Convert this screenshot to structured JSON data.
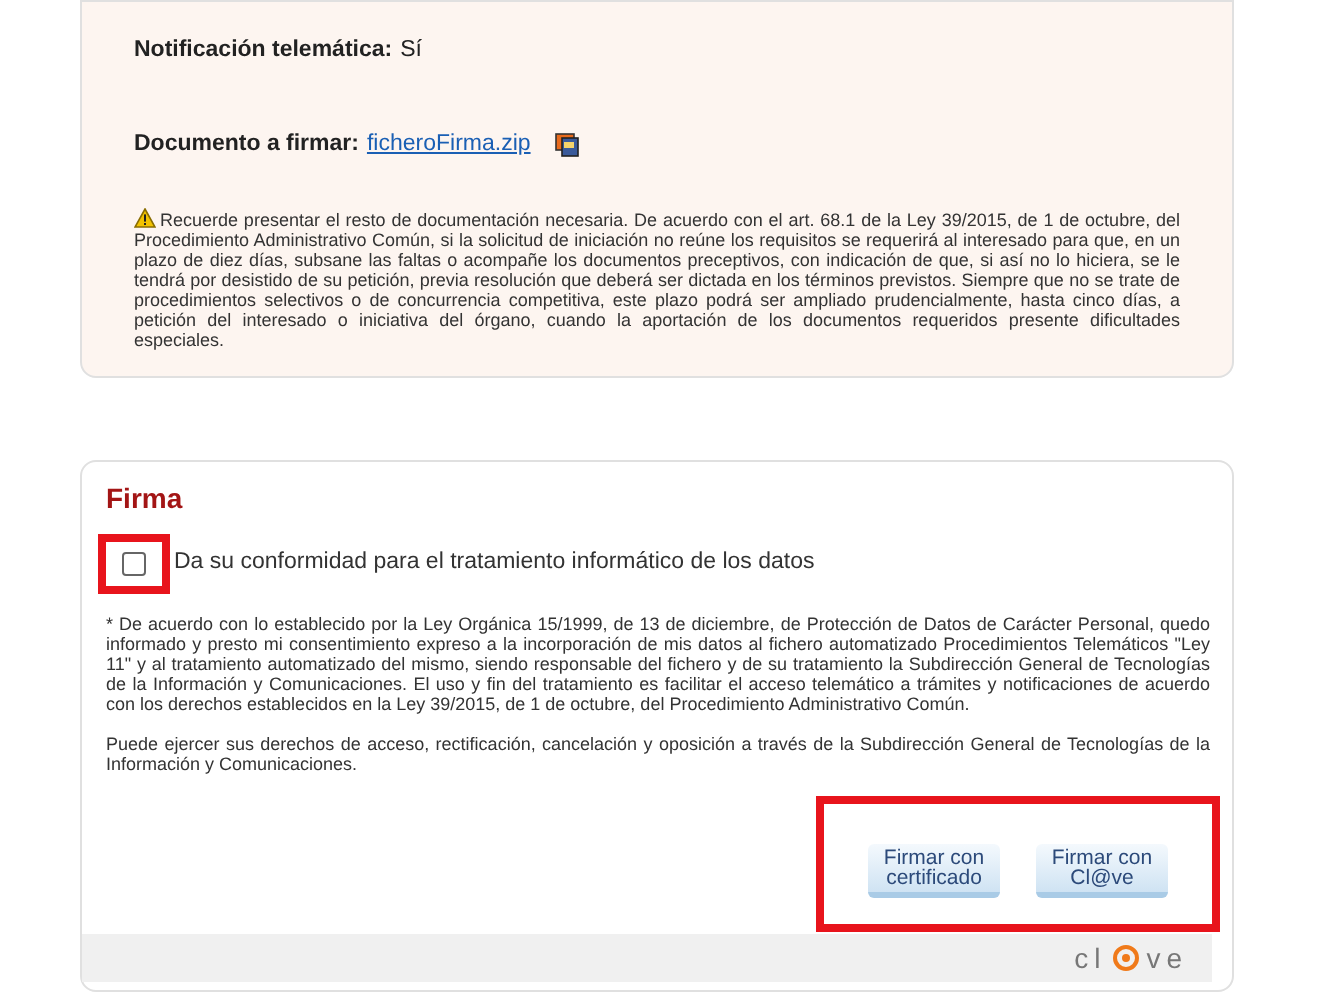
{
  "summary": {
    "fields": [
      {
        "label": "Notificación telemática:",
        "value": "Sí",
        "kind": "text"
      },
      {
        "label": "Documento a firmar:",
        "value": "ficheroFirma.zip",
        "kind": "link"
      }
    ],
    "notice": "Recuerde presentar el resto de documentación necesaria. De acuerdo con el art. 68.1 de la Ley 39/2015, de 1 de octubre, del Procedimiento Administrativo Común, si la solicitud de iniciación no reúne los requisitos se requerirá al interesado para que, en un plazo de diez días, subsane las faltas o acompañe los documentos preceptivos, con indicación de que, si así no lo hiciera, se le tendrá por desistido de su petición, previa resolución que deberá ser dictada en los términos previstos. Siempre que no se trate de procedimientos selectivos o de concurrencia competitiva, este plazo podrá ser ampliado prudencialmente, hasta cinco días, a petición del interesado o iniciativa del órgano, cuando la aportación de los documentos requeridos presente dificultades especiales."
  },
  "firma": {
    "title": "Firma",
    "consent": {
      "label": "Da su conformidad para el tratamiento informático de los datos",
      "checked": false,
      "highlighted": true
    },
    "paragraphs": [
      "* De acuerdo con lo establecido por la Ley Orgánica 15/1999, de 13 de diciembre, de Protección de Datos de Carácter Personal, quedo informado y presto mi consentimiento expreso a la incorporación de mis datos al fichero automatizado Procedimientos Telemáticos \"Ley 11\" y al tratamiento automatizado del mismo, siendo responsable del fichero y de su tratamiento la Subdirección General de Tecnologías de la Información y Comunicaciones. El uso y fin del tratamiento es facilitar el acceso telemático a trámites y notificaciones de acuerdo con los derechos establecidos en la Ley 39/2015, de 1 de octubre, del Procedimiento Administrativo Común.",
      "Puede ejercer sus derechos de acceso, rectificación, cancelación y oposición a través de la Subdirección General de Tecnologías de la Información y Comunicaciones."
    ],
    "buttons": [
      {
        "line1": "Firmar con",
        "line2": "certificado"
      },
      {
        "line1": "Firmar con",
        "line2": "Cl@ve"
      }
    ],
    "buttons_highlighted": true,
    "logo": {
      "before": "cl",
      "after": "ve"
    }
  }
}
